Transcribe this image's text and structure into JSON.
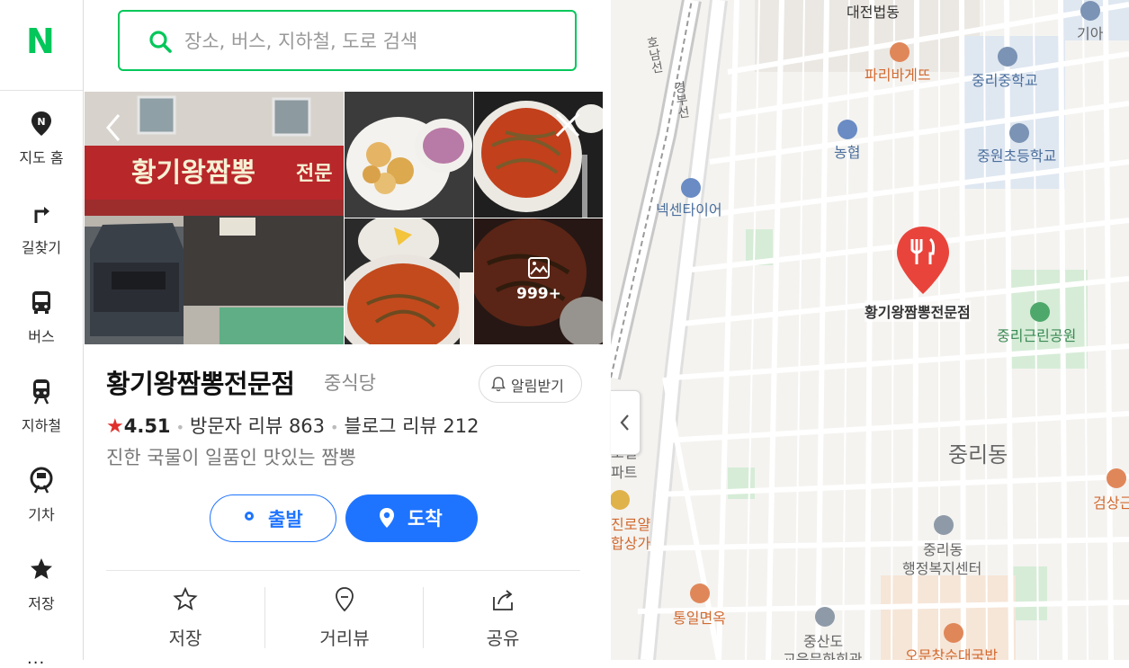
{
  "app": {
    "logo": "N",
    "brand_color": "#03c75a",
    "accent_color": "#1e74ff"
  },
  "rail": {
    "items": [
      {
        "label": "지도 홈",
        "icon": "map-home-icon"
      },
      {
        "label": "길찾기",
        "icon": "directions-icon"
      },
      {
        "label": "버스",
        "icon": "bus-icon"
      },
      {
        "label": "지하철",
        "icon": "subway-icon"
      },
      {
        "label": "기차",
        "icon": "train-icon"
      },
      {
        "label": "저장",
        "icon": "star-icon"
      }
    ],
    "more": "..."
  },
  "search": {
    "placeholder": "장소, 버스, 지하철, 도로 검색",
    "value": ""
  },
  "photos": {
    "count_label": "999+"
  },
  "place": {
    "name": "황기왕짬뽕전문점",
    "category": "중식당",
    "alert_label": "알림받기",
    "star": "★",
    "rating": "4.51",
    "visitor_reviews": "방문자 리뷰 863",
    "blog_reviews": "블로그 리뷰 212",
    "description": "진한 국물이 일품인 맛있는 짬뽕"
  },
  "route": {
    "start_label": "출발",
    "arrive_label": "도착"
  },
  "actions": [
    {
      "label": "저장",
      "icon": "star-outline-icon"
    },
    {
      "label": "거리뷰",
      "icon": "street-view-icon"
    },
    {
      "label": "공유",
      "icon": "share-icon"
    }
  ],
  "map": {
    "labels": {
      "daejeon": "대전법동",
      "kia": "기아",
      "paris": "파리바게뜨",
      "jungni_mid": "중리중학교",
      "nonghyup": "농협",
      "jungwon_elem": "중원초등학교",
      "nexen": "넥센타이어",
      "rail_line": "경부선",
      "rail_line2": "호남선",
      "marker": "황기왕짬뽕전문점",
      "park": "중리근린공원",
      "dong": "중리동",
      "gyeol": "로결",
      "apt": "파트",
      "jinro": "진로얄",
      "mall": "합상가",
      "center1": "중리동",
      "center2": "행정복지센터",
      "tongil": "통일면옥",
      "geomsang": "검상근",
      "jungsan1": "중산도",
      "jungsan2": "교육문화회관",
      "owoon": "오문창순대국밥"
    }
  }
}
